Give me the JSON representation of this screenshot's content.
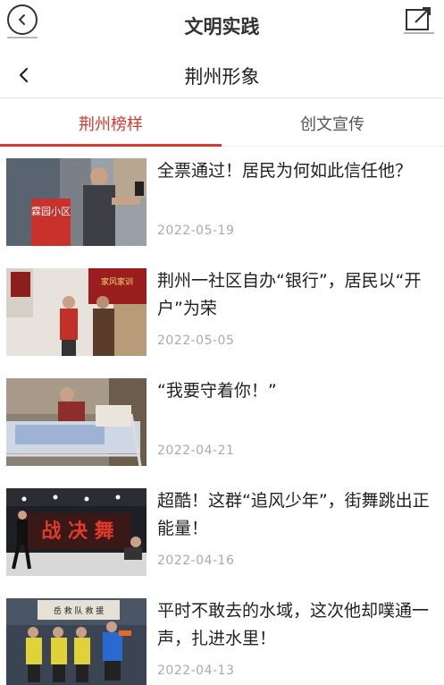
{
  "header": {
    "title": "文明实践"
  },
  "subheader": {
    "title": "荆州形象"
  },
  "tabs": [
    {
      "label": "荆州榜样",
      "active": true
    },
    {
      "label": "创文宣传",
      "active": false
    }
  ],
  "articles": [
    {
      "title": "全票通过！居民为何如此信任他？",
      "date": "2022-05-19",
      "image": "elderly-man-at-community-gate"
    },
    {
      "title": "荆州一社区自办“银行”，居民以“开户”为荣",
      "date": "2022-05-05",
      "image": "residents-at-community-bank"
    },
    {
      "title": "“我要守着你！”",
      "date": "2022-04-21",
      "image": "woman-caring-for-bedridden-patient"
    },
    {
      "title": "超酷！这群“追风少年”，街舞跳出正能量！",
      "date": "2022-04-16",
      "image": "street-dance-competition-stage"
    },
    {
      "title": "平时不敢去的水域，这次他却噗通一声，扎进水里！",
      "date": "2022-04-13",
      "image": "rescue-team-in-life-vests"
    }
  ],
  "thumb_texts": {
    "gate_sign": "霖园小区",
    "bank_sign": "家风家训",
    "dance_banner": "战 决 舞",
    "rescue_banner": "岳 救 队 救 援"
  },
  "colors": {
    "accent": "#d63a2f",
    "date": "#aaaaaa"
  }
}
